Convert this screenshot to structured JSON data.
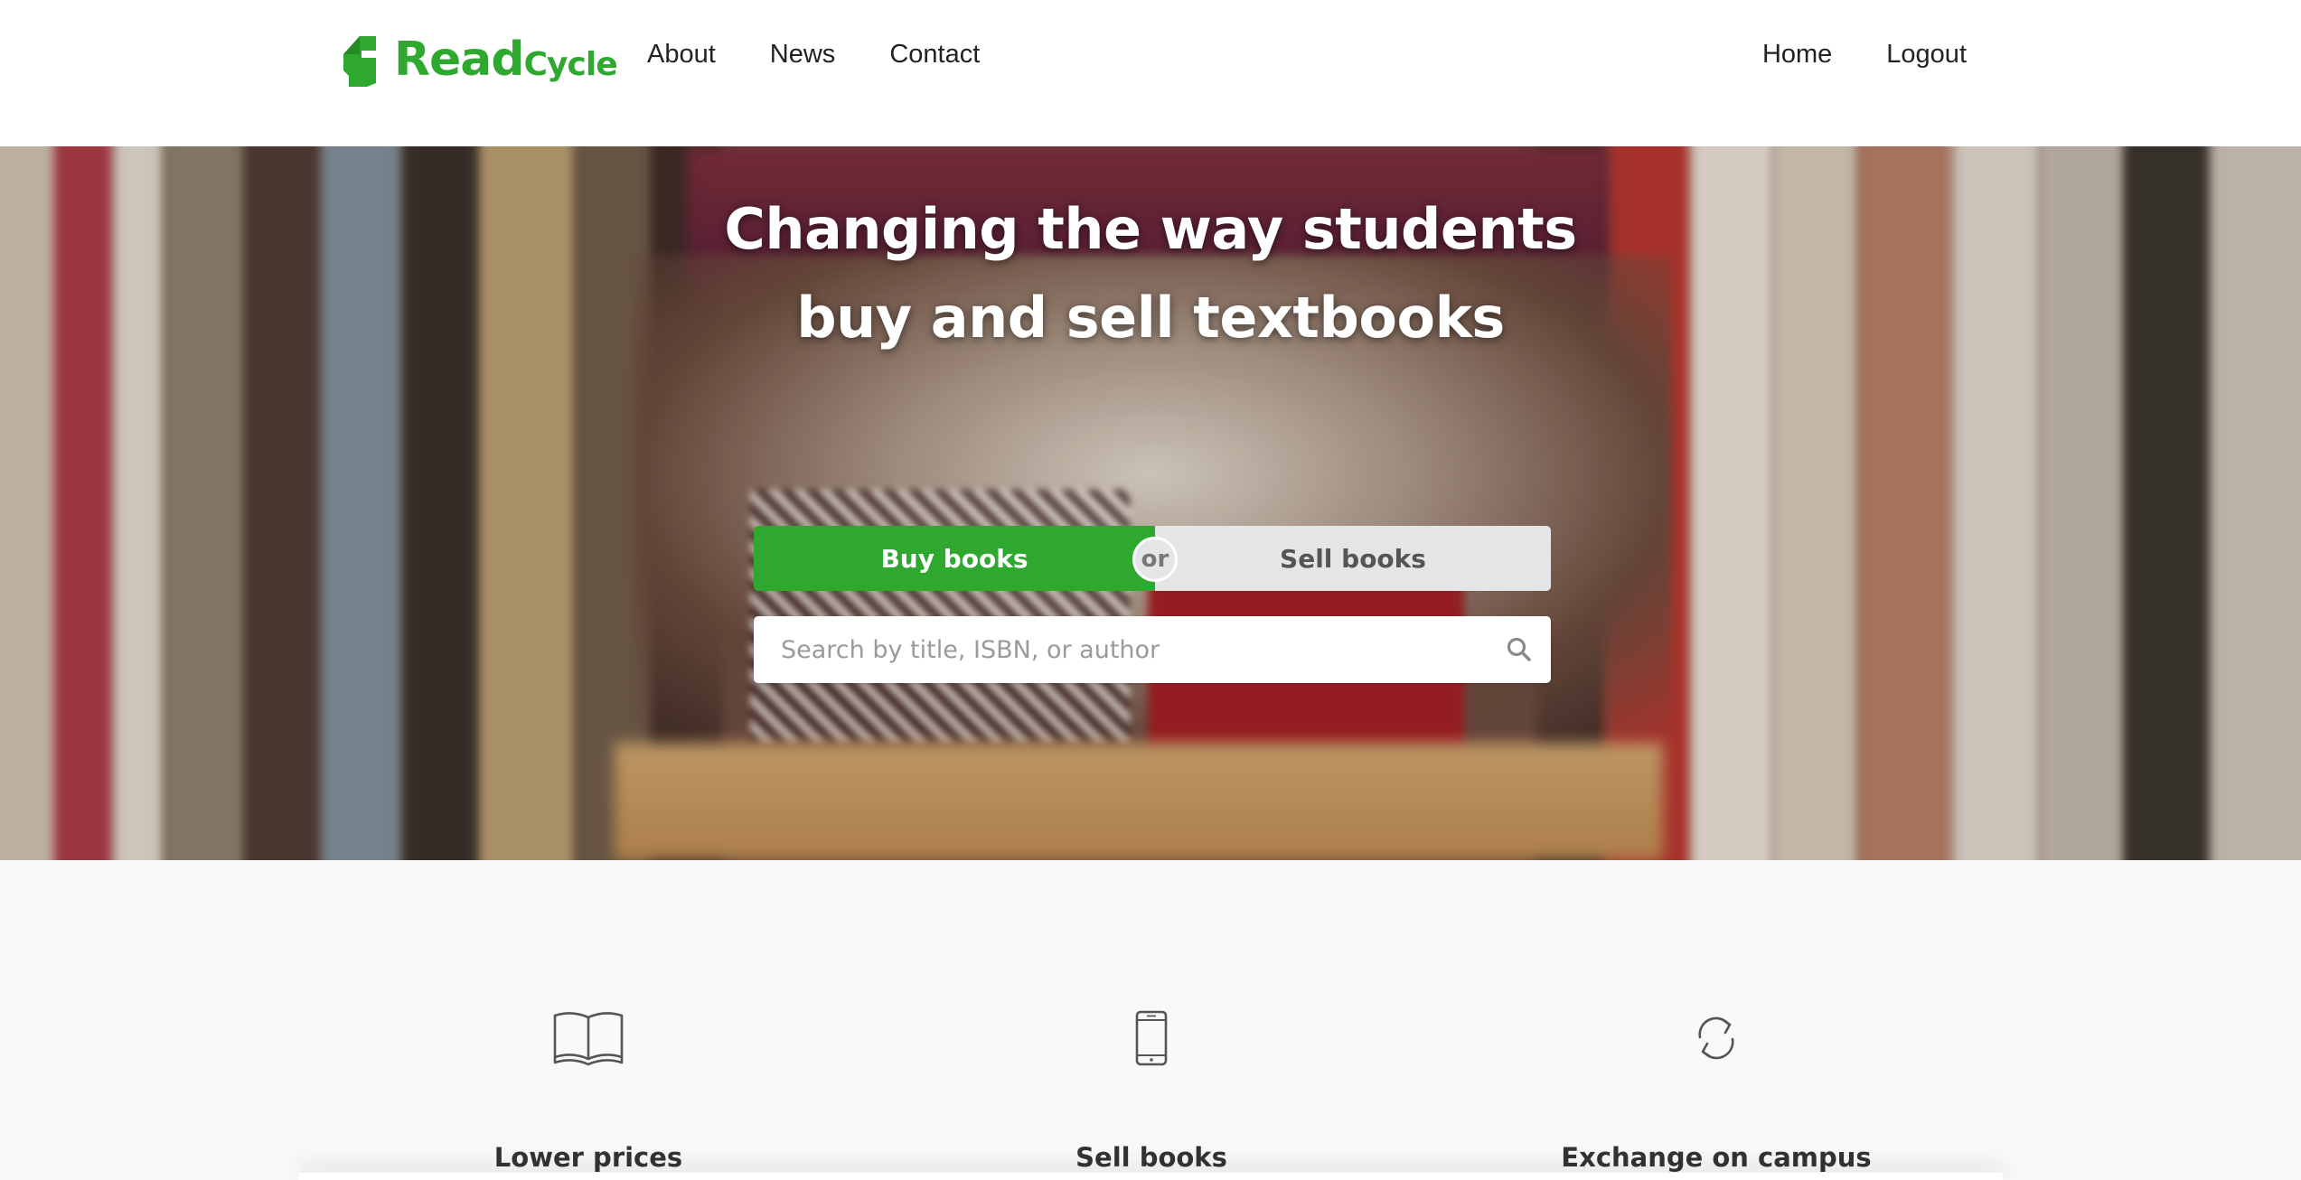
{
  "header": {
    "logo": {
      "read": "Read",
      "cycle": "Cycle",
      "mark_icon": "readcycle-arrow-logo",
      "brand_color": "#2fa830"
    },
    "nav_left": [
      "About",
      "News",
      "Contact"
    ],
    "nav_right": [
      "Home",
      "Logout"
    ]
  },
  "hero": {
    "title_line1": "Changing the way students",
    "title_line2": "buy and sell textbooks",
    "toggle": {
      "buy_label": "Buy books",
      "or_label": "or",
      "sell_label": "Sell books",
      "active": "buy"
    },
    "search": {
      "placeholder": "Search by title, ISBN, or author",
      "value": "",
      "icon": "search-icon"
    }
  },
  "features": [
    {
      "title": "Lower prices",
      "icon": "open-book-icon"
    },
    {
      "title": "Sell books",
      "icon": "mobile-phone-icon"
    },
    {
      "title": "Exchange on campus",
      "icon": "refresh-cycle-icon"
    }
  ],
  "colors": {
    "accent": "#2fa830",
    "toggle_inactive": "#e4e5e6",
    "page_bg": "#f9f9f9"
  }
}
